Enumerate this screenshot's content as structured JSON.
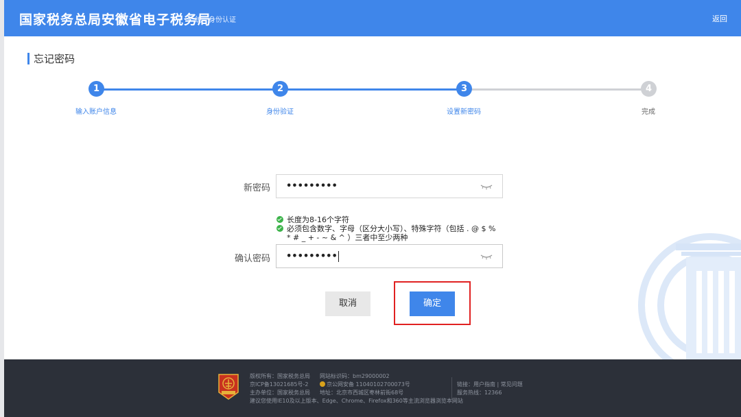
{
  "header": {
    "title": "国家税务总局安徽省电子税务局",
    "subtitle": "统一身份认证",
    "back_label": "返回"
  },
  "page_title": "忘记密码",
  "steps": [
    {
      "number": "1",
      "label": "输入账户信息",
      "status": "done"
    },
    {
      "number": "2",
      "label": "身份验证",
      "status": "done"
    },
    {
      "number": "3",
      "label": "设置新密码",
      "status": "active"
    },
    {
      "number": "4",
      "label": "完成",
      "status": "pending"
    }
  ],
  "form": {
    "new_password_label": "新密码",
    "new_password_value": "•••••••••",
    "confirm_password_label": "确认密码",
    "confirm_password_value": "•••••••••",
    "rules": [
      "长度为8-16个字符",
      "必须包含数字、字母（区分大小写）、特殊字符（包括 . @ $ %",
      "* # _ + - ~ & ^ ）三者中至少两种"
    ],
    "cancel_label": "取消",
    "confirm_label": "确定"
  },
  "colors": {
    "primary": "#3f86ea",
    "pending": "#cfd1d5",
    "highlight": "#e02020",
    "check": "#3cb34a",
    "footer_bg": "#2c3039"
  },
  "footer": {
    "col1": [
      "版权所有：国家税务总局",
      "京ICP备13021685号-2",
      "主办单位：国家税务总局",
      "建议您使用IE10及以上版本、Edge、Chrome、Firefox和360等主流浏览器浏览本网站"
    ],
    "col2": [
      "网站标识码：bm29000002",
      "京公网安备 11040102700073号",
      "地址：北京市西城区枣林前街68号"
    ],
    "col3": [
      "链接：用户指南 | 常见问题",
      "服务热线：12366"
    ]
  },
  "icons": {
    "eye": "eye-closed-icon",
    "check": "check-circle-icon",
    "logo": "tax-emblem-logo"
  }
}
